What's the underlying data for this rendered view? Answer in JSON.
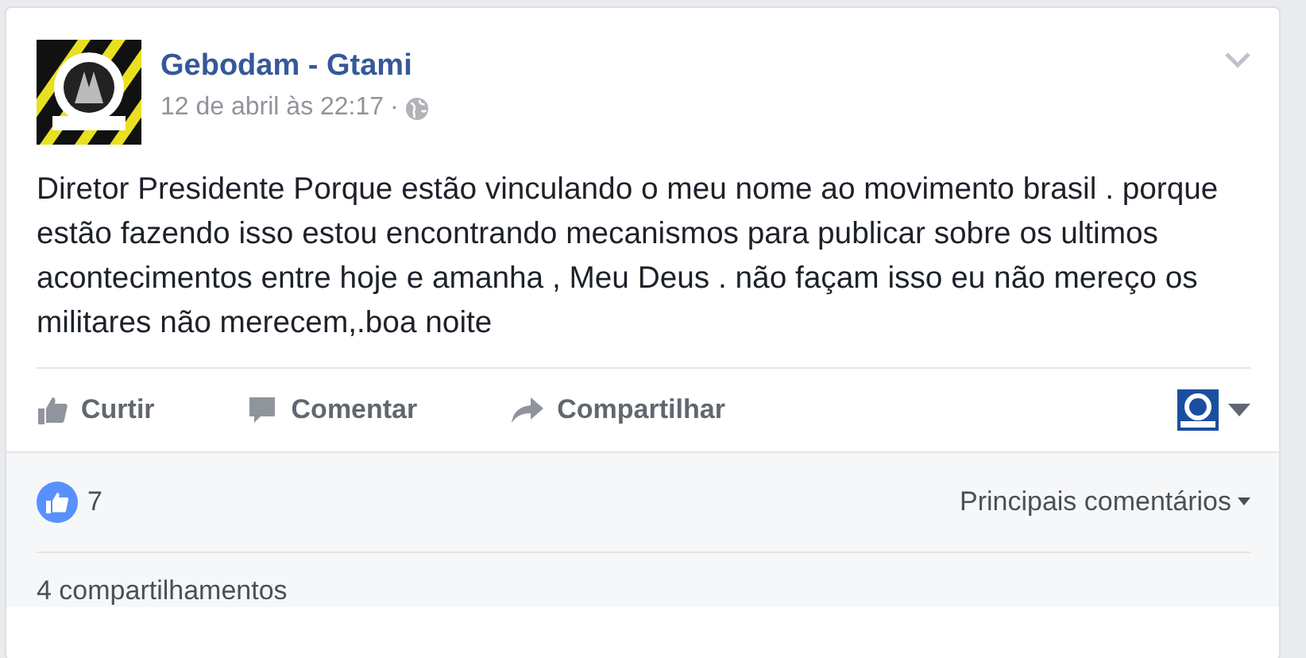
{
  "post": {
    "author": "Gebodam - Gtami",
    "timestamp": "12 de abril às 22:17",
    "separator": "·",
    "text": "Diretor Presidente Porque estão vinculando o meu nome ao movimento brasil . porque estão fazendo isso estou encontrando mecanismos para publicar sobre os ultimos acontecimentos entre hoje e amanha , Meu Deus . não façam isso eu não mereço os militares não merecem,.boa noite"
  },
  "actions": [
    {
      "kind": "like",
      "label": "Curtir"
    },
    {
      "kind": "comment",
      "label": "Comentar"
    },
    {
      "kind": "share",
      "label": "Compartilhar"
    }
  ],
  "footer": {
    "likes": "7",
    "sort": "Principais comentários",
    "shares": "4 compartilhamentos"
  }
}
